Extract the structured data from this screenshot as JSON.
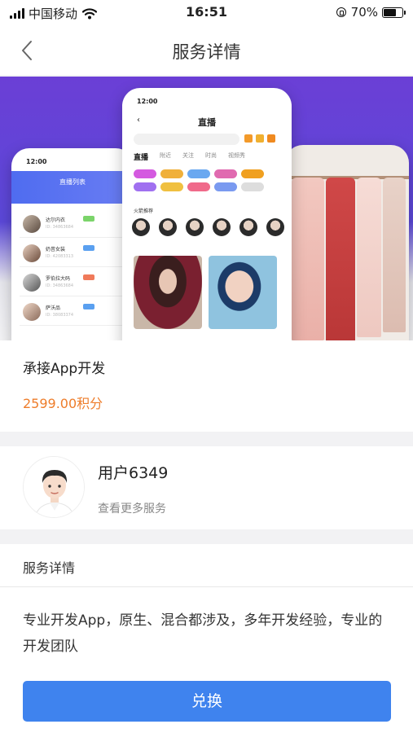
{
  "status_bar": {
    "carrier": "中国移动",
    "time": "16:51",
    "battery_percent": "70%",
    "battery_level": 0.7,
    "icons": [
      "signal-icon",
      "wifi-icon",
      "orientation-lock-icon",
      "battery-icon"
    ]
  },
  "nav": {
    "title": "服务详情",
    "back_icon": "chevron-left-icon"
  },
  "banner": {
    "phone_time": "12:00",
    "left_screen_title": "直播列表",
    "center_screen_title": "直播",
    "center_tabs": [
      "直播",
      "附近",
      "关注",
      "时尚",
      "视频秀"
    ],
    "center_section": "火箭推荐",
    "left_list_names": [
      "达尔内衣",
      "奶昔女装",
      "罗伯拉大码",
      "萨沃品"
    ]
  },
  "product": {
    "title": "承接App开发",
    "price": "2599.00积分",
    "price_color": "#ee7d2b"
  },
  "seller": {
    "name": "用户6349",
    "more_link": "查看更多服务"
  },
  "detail": {
    "heading": "服务详情",
    "body": "专业开发App，原生、混合都涉及，多年开发经验，专业的开发团队"
  },
  "action": {
    "exchange_label": "兑换",
    "color": "#3f83ee"
  }
}
